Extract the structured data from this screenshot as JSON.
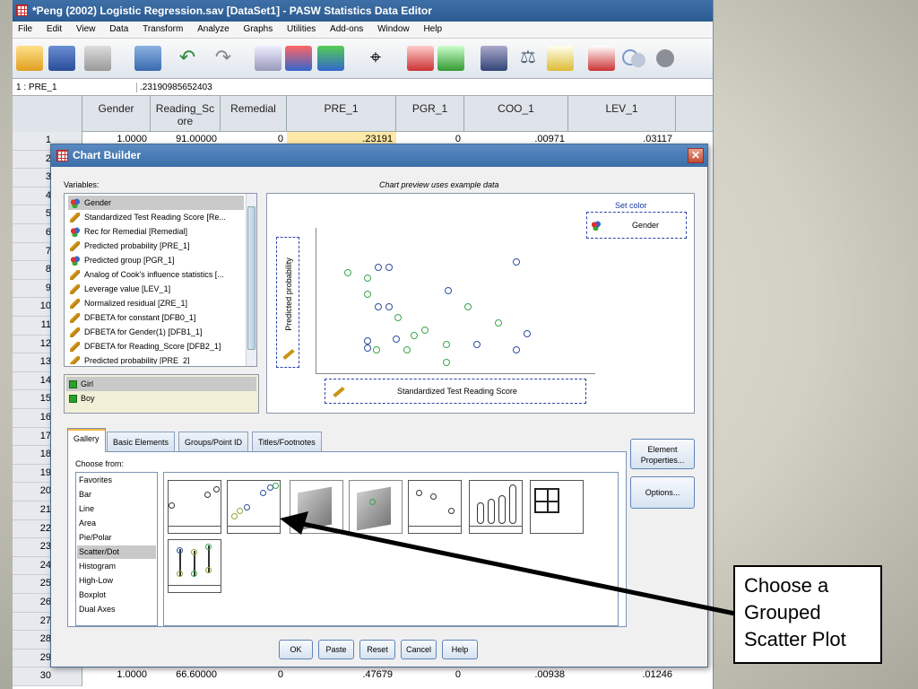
{
  "window": {
    "title": "*Peng (2002) Logistic Regression.sav [DataSet1] - PASW Statistics Data Editor"
  },
  "menu": [
    "File",
    "Edit",
    "View",
    "Data",
    "Transform",
    "Analyze",
    "Graphs",
    "Utilities",
    "Add-ons",
    "Window",
    "Help"
  ],
  "cell_ref": {
    "name": "1 : PRE_1",
    "value": ".23190985652403"
  },
  "columns": [
    "Gender",
    "Reading_Score",
    "Remedial",
    "PRE_1",
    "PGR_1",
    "COO_1",
    "LEV_1"
  ],
  "row1": {
    "gender": "1.0000",
    "reading": "91.00000",
    "remedial": "0",
    "pre": ".23191",
    "pgr": "0",
    "coo": ".00971",
    "lev": ".03117"
  },
  "row_numbers": [
    "1",
    "2",
    "3",
    "4",
    "5",
    "6",
    "7",
    "8",
    "9",
    "10",
    "11",
    "12",
    "13",
    "14",
    "15",
    "16",
    "17",
    "18",
    "19",
    "20",
    "21",
    "22",
    "23",
    "24",
    "25",
    "26",
    "27",
    "28",
    "29",
    "30"
  ],
  "last_row": {
    "gender": "1.0000",
    "reading": "66.60000",
    "remedial": "0",
    "pre": ".47679",
    "pgr": "0",
    "coo": ".00938",
    "lev": ".01246"
  },
  "dialog": {
    "title": "Chart Builder",
    "variables_label": "Variables:",
    "preview_note": "Chart preview uses example data",
    "variables": [
      {
        "label": "Gender",
        "icon": "nominal-icon"
      },
      {
        "label": "Standardized Test Reading Score [Re...",
        "icon": "scale-icon"
      },
      {
        "label": "Rec for Remedial [Remedial]",
        "icon": "nominal-icon"
      },
      {
        "label": "Predicted probability [PRE_1]",
        "icon": "scale-icon"
      },
      {
        "label": "Predicted group [PGR_1]",
        "icon": "nominal-icon"
      },
      {
        "label": "Analog of Cook's influence statistics [...",
        "icon": "scale-icon"
      },
      {
        "label": "Leverage value [LEV_1]",
        "icon": "scale-icon"
      },
      {
        "label": "Normalized residual [ZRE_1]",
        "icon": "scale-icon"
      },
      {
        "label": "DFBETA for constant [DFB0_1]",
        "icon": "scale-icon"
      },
      {
        "label": "DFBETA for Gender(1) [DFB1_1]",
        "icon": "scale-icon"
      },
      {
        "label": "DFBETA for Reading_Score [DFB2_1]",
        "icon": "scale-icon"
      },
      {
        "label": "Predicted probability [PRE_2]",
        "icon": "scale-icon"
      }
    ],
    "categories": [
      "Girl",
      "Boy"
    ],
    "set_color_label": "Set color",
    "set_color_var": "Gender",
    "y_axis": "Predicted probability",
    "x_axis": "Standardized Test Reading Score",
    "tabs": [
      "Gallery",
      "Basic Elements",
      "Groups/Point ID",
      "Titles/Footnotes"
    ],
    "choose_from_label": "Choose from:",
    "gallery_types": [
      "Favorites",
      "Bar",
      "Line",
      "Area",
      "Pie/Polar",
      "Scatter/Dot",
      "Histogram",
      "High-Low",
      "Boxplot",
      "Dual Axes"
    ],
    "side_buttons": {
      "element_properties": "Element Properties...",
      "options": "Options..."
    },
    "buttons": {
      "ok": "OK",
      "paste": "Paste",
      "reset": "Reset",
      "cancel": "Cancel",
      "help": "Help"
    }
  },
  "callout": {
    "line1": "Choose a",
    "line2": "Grouped",
    "line3": "Scatter Plot"
  },
  "colors": {
    "series_blue": "#2c4fa0",
    "series_green": "#37a84a",
    "title_bar": "#3b6ea8"
  }
}
